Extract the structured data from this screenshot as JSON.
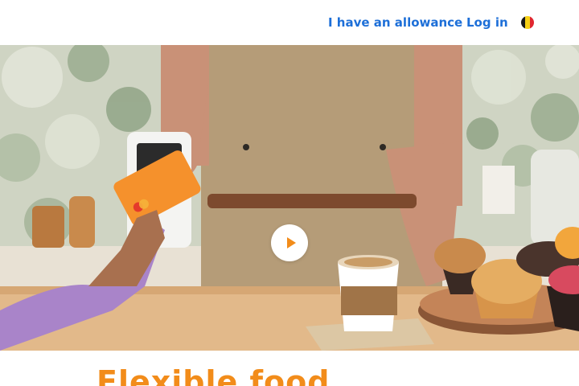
{
  "header": {
    "allowance_link": "I have an allowance",
    "login_link": "Log in",
    "flag_colors": [
      "#1a1a1a",
      "#f7d117",
      "#e0262f"
    ]
  },
  "hero": {
    "card_brand": "mastercard",
    "play_icon": "play-icon",
    "accent_color": "#f28c1a"
  },
  "main": {
    "heading": "Flexible food"
  }
}
